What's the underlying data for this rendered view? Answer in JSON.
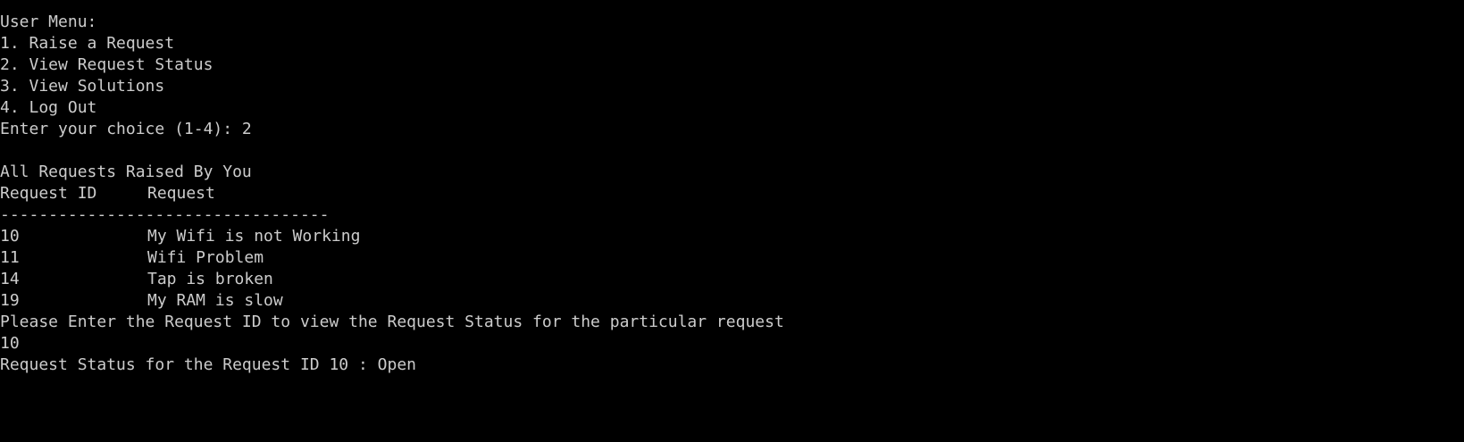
{
  "menu": {
    "title": "User Menu:",
    "items": [
      "1. Raise a Request",
      "2. View Request Status",
      "3. View Solutions",
      "4. Log Out"
    ],
    "prompt": "Enter your choice (1-4): 2"
  },
  "requests": {
    "heading": "All Requests Raised By You",
    "columns": [
      "Request ID",
      "Request"
    ],
    "separator": "----------------------------------",
    "rows": [
      {
        "id": "10",
        "request": "My Wifi is not Working"
      },
      {
        "id": "11",
        "request": "Wifi Problem"
      },
      {
        "id": "14",
        "request": "Tap is broken"
      },
      {
        "id": "19",
        "request": "My RAM is slow"
      }
    ]
  },
  "status": {
    "prompt": "Please Enter the Request ID to view the Request Status for the particular request",
    "input": "10",
    "result": "Request Status for the Request ID 10 : Open"
  },
  "colors": {
    "background": "#000000",
    "text": "#cccccc"
  }
}
